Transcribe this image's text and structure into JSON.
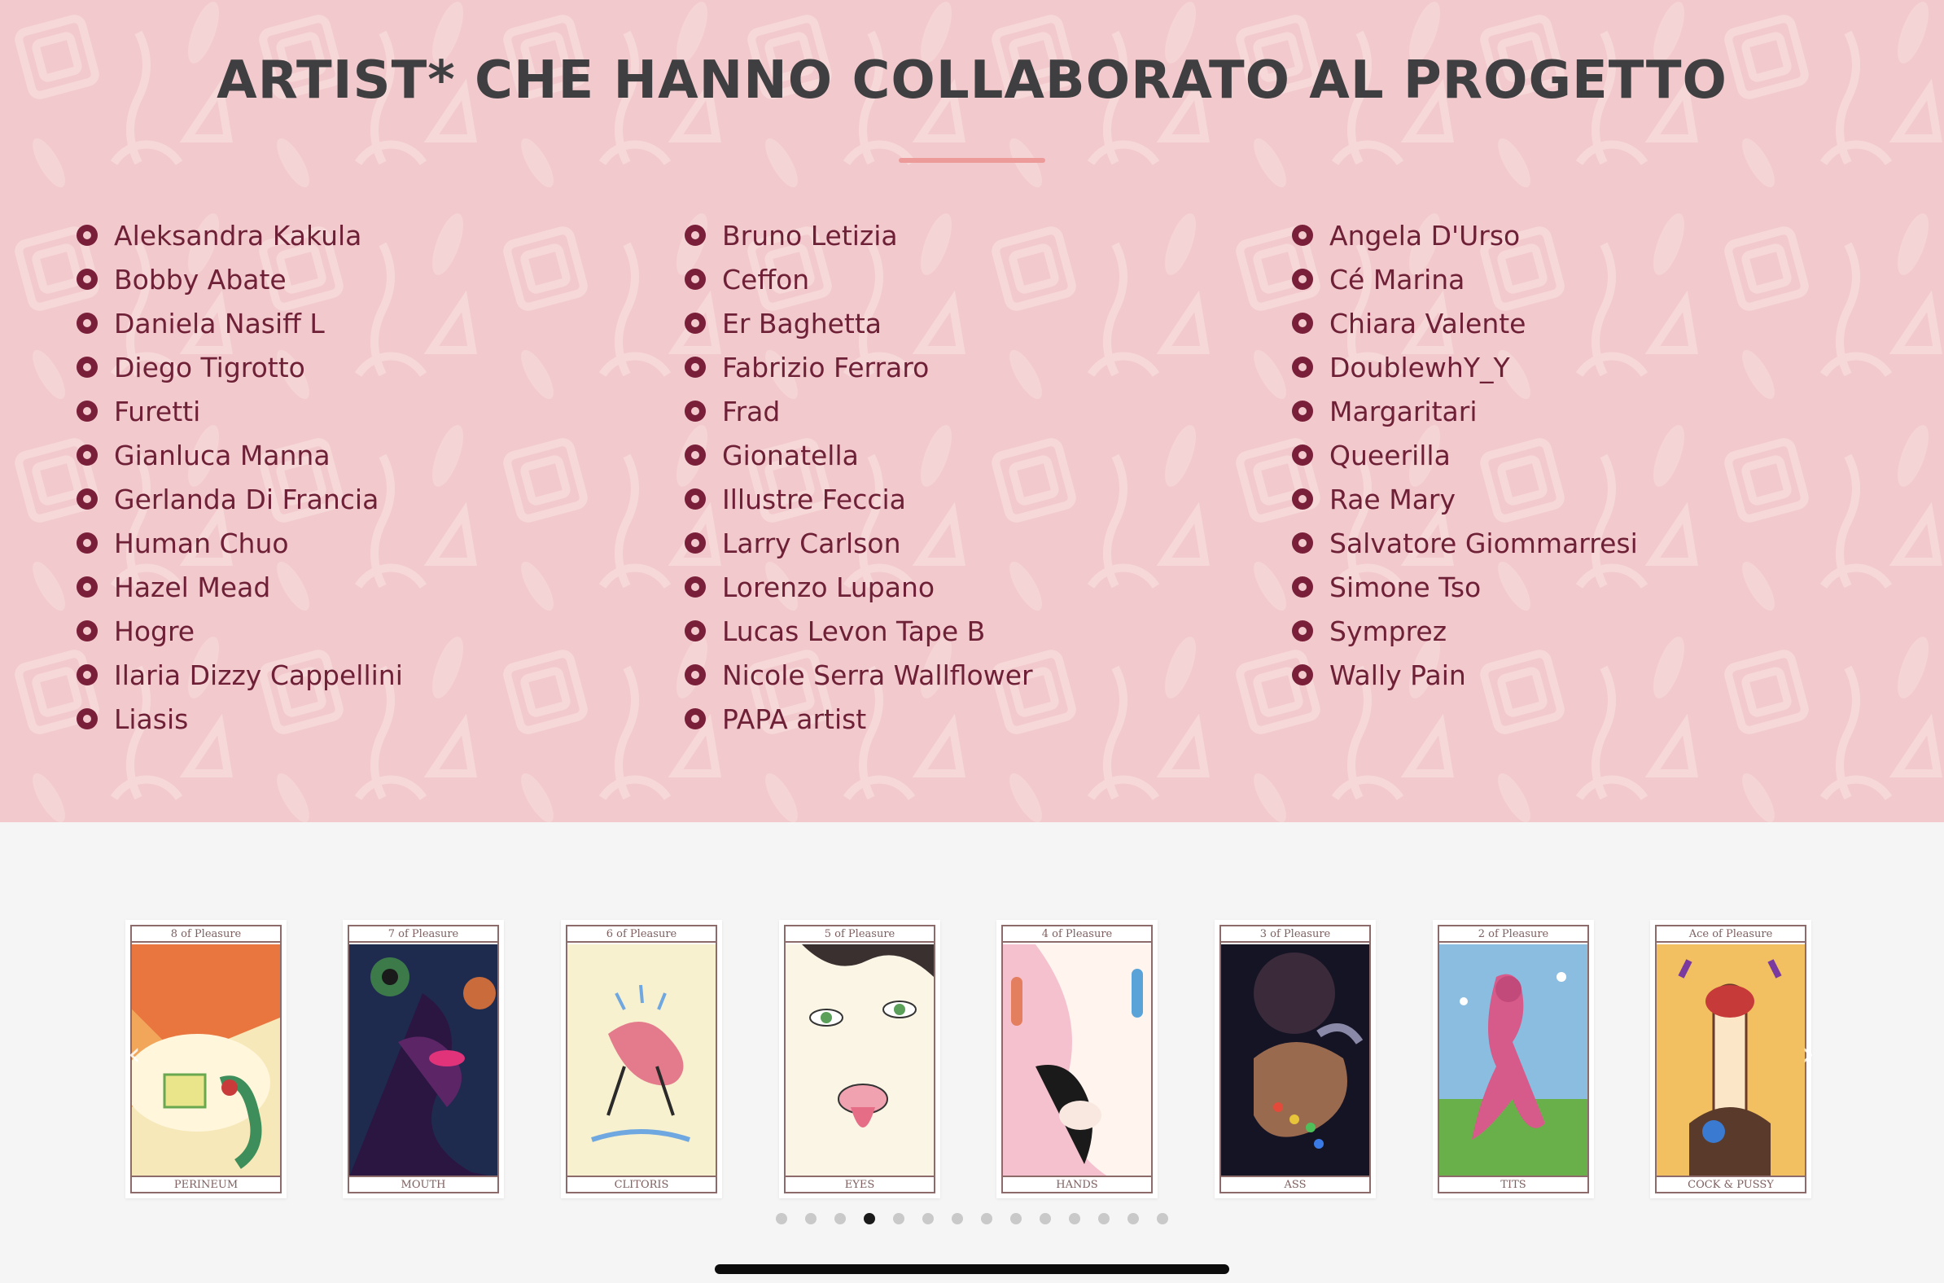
{
  "section_title": "ARTIST* CHE HANNO COLLABORATO AL PROGETTO",
  "artists": {
    "column_1": [
      "Aleksandra Kakula",
      "Bobby Abate",
      "Daniela Nasiff L",
      "Diego Tigrotto",
      "Furetti",
      "Gianluca Manna",
      "Gerlanda Di Francia",
      "Human Chuo",
      "Hazel Mead",
      "Hogre",
      "Ilaria Dizzy Cappellini",
      "Liasis"
    ],
    "column_2": [
      "Bruno Letizia",
      "Ceffon",
      "Er Baghetta",
      "Fabrizio Ferraro",
      "Frad",
      "Gionatella",
      "Illustre Feccia",
      "Larry Carlson",
      "Lorenzo Lupano",
      "Lucas Levon Tape B",
      "Nicole Serra Wallflower",
      "PAPA artist"
    ],
    "column_3": [
      "Angela D'Urso",
      "Cé Marina",
      "Chiara Valente",
      "DoublewhY_Y",
      "Margaritari",
      "Queerilla",
      "Rae Mary",
      "Salvatore Giommarresi",
      "Simone Tso",
      "Symprez",
      "Wally Pain"
    ]
  },
  "colors": {
    "section_bg": "#f2c9cc",
    "title": "#3f3f41",
    "underline": "#ec9b9a",
    "bullet": "#7a1f3a",
    "artist_text": "#6e2037",
    "carousel_bg": "#f5f5f5",
    "dot_active": "#1a1a1a",
    "dot_inactive": "#c9c9c9"
  },
  "carousel": {
    "prev_icon": "chevron-left-icon",
    "next_icon": "chevron-right-icon",
    "prev_glyph": "‹",
    "next_glyph": "›",
    "cards": [
      {
        "top": "8 of Pleasure",
        "bottom": "PERINEUM"
      },
      {
        "top": "7 of Pleasure",
        "bottom": "MOUTH"
      },
      {
        "top": "6 of Pleasure",
        "bottom": "CLITORIS"
      },
      {
        "top": "5 of Pleasure",
        "bottom": "EYES"
      },
      {
        "top": "4 of Pleasure",
        "bottom": "HANDS"
      },
      {
        "top": "3 of Pleasure",
        "bottom": "ASS"
      },
      {
        "top": "2 of Pleasure",
        "bottom": "TITS"
      },
      {
        "top": "Ace of Pleasure",
        "bottom": "COCK & PUSSY"
      }
    ],
    "dot_count": 14,
    "active_dot": 3
  }
}
